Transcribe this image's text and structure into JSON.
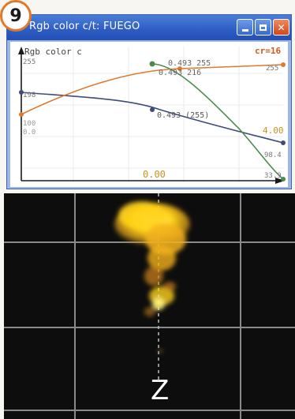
{
  "step_badge": "9",
  "window": {
    "title": "Rgb color c/t: FUEGO",
    "buttons": [
      "minimize",
      "maximize",
      "close"
    ]
  },
  "graph": {
    "header_label": "Rgb color c",
    "cr_label": "cr=16",
    "readout_top": "0.493 255",
    "readout_top2": "0.493 216",
    "readout_mid": "0.493 (255)",
    "left_labels": [
      "255",
      "198",
      "100",
      "0.0"
    ],
    "right_labels": [
      "255",
      "4.00",
      "98.4",
      "33.9"
    ],
    "x_label": "0.00",
    "colors": {
      "orange": "#e0792f",
      "green": "#4d8a4f",
      "blue": "#3e4b7c",
      "axis": "#1a1a1a",
      "grid": "#ebebeb"
    }
  },
  "viewport": {
    "axis_label": "Z",
    "grid_color": "#8a8a8a",
    "fire_colors": [
      "#ffd21a",
      "#f2b21c",
      "#c77c1c"
    ]
  }
}
